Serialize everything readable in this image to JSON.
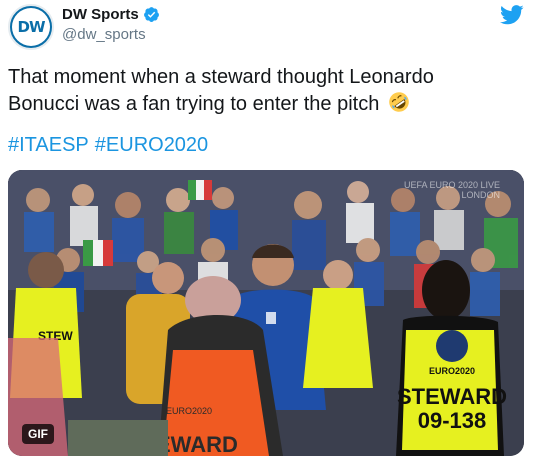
{
  "account": {
    "display_name": "DW Sports",
    "handle": "@dw_sports",
    "avatar_text": "DW"
  },
  "tweet": {
    "text": "That moment when a steward thought Leonardo Bonucci was a fan trying to enter the pitch",
    "hashtags": [
      "#ITAESP",
      "#EURO2020"
    ]
  },
  "media": {
    "badge": "GIF",
    "watermark_line1": "UEFA EURO 2020 LIVE",
    "watermark_line2": "LONDON",
    "vest_back_text": "STEWARD",
    "vest_back_number": "09-138",
    "vest_front_text": "EURO2020",
    "left_vest_text": "STEW",
    "bottom_vest_text": "EWARD"
  },
  "colors": {
    "brand_blue": "#1da1f2",
    "link_blue": "#1b95e0",
    "dw_blue": "#0a6ea8",
    "vest_yellow": "#e6f020",
    "vest_orange": "#f05a22",
    "italy_blue": "#1f4fa8"
  }
}
